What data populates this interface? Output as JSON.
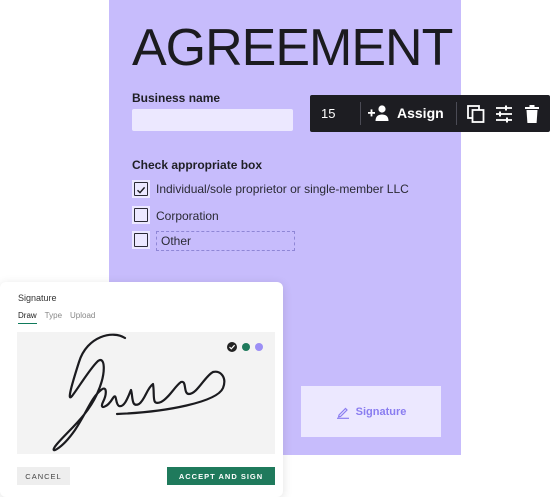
{
  "document": {
    "title": "AGREEMENT",
    "business_name_label": "Business name",
    "business_name_value": "",
    "check_label": "Check appropriate box",
    "options": [
      {
        "label": "Individual/sole proprietor or single-member LLC",
        "checked": true
      },
      {
        "label": "Corporation",
        "checked": false
      },
      {
        "label": "Other",
        "checked": false
      }
    ],
    "signature_field_label": "Signature"
  },
  "toolbar": {
    "font_size": "15",
    "assign_label": "Assign",
    "icons": [
      "add-person-icon",
      "copy-icon",
      "settings-sliders-icon",
      "trash-icon"
    ]
  },
  "signature_panel": {
    "title": "Signature",
    "tabs": [
      {
        "label": "Draw",
        "active": true
      },
      {
        "label": "Type",
        "active": false
      },
      {
        "label": "Upload",
        "active": false
      }
    ],
    "colors": [
      "#222222",
      "#1f7a5c",
      "#9c8ff5"
    ],
    "selected_color": "#222222",
    "cancel_label": "CANCEL",
    "accept_label": "ACCEPT AND SIGN"
  },
  "accent": {
    "document_bg": "#c7bcfc",
    "primary_green": "#1f7a5c"
  }
}
